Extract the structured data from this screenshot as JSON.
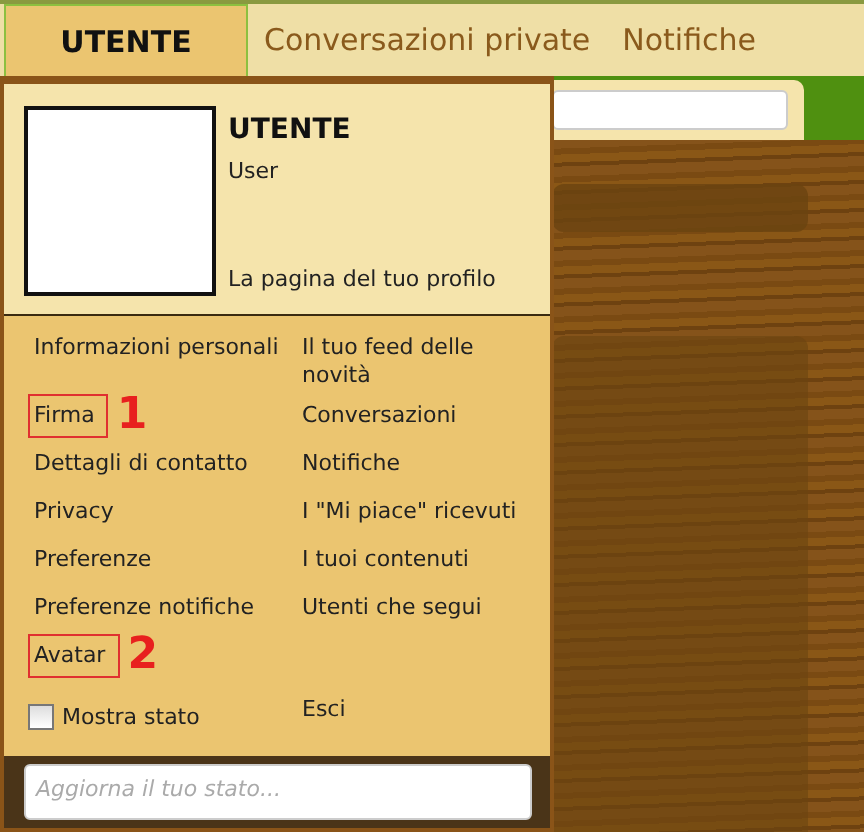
{
  "nav_tabs": [
    {
      "label": "UTENTE",
      "selected": true
    },
    {
      "label": "Conversazioni private",
      "selected": false
    },
    {
      "label": "Notifiche",
      "selected": false
    }
  ],
  "profile": {
    "name": "UTENTE",
    "role": "User",
    "profile_link": "La pagina del tuo profilo"
  },
  "menu_left": [
    {
      "label": "Informazioni personali"
    },
    {
      "label": "Firma",
      "marker": "1"
    },
    {
      "label": "Dettagli di contatto"
    },
    {
      "label": "Privacy"
    },
    {
      "label": "Preferenze"
    },
    {
      "label": "Preferenze notifiche"
    },
    {
      "label": "Avatar",
      "marker": "2"
    }
  ],
  "menu_right": [
    {
      "label": "Il tuo feed delle novità"
    },
    {
      "label": "Conversazioni"
    },
    {
      "label": "Notifiche"
    },
    {
      "label": "I \"Mi piace\" ricevuti"
    },
    {
      "label": "I tuoi contenuti"
    },
    {
      "label": "Utenti che segui"
    }
  ],
  "show_status": {
    "label": "Mostra stato",
    "checked": false
  },
  "logout": "Esci",
  "status_field": {
    "placeholder": "Aggiorna il tuo stato..."
  }
}
